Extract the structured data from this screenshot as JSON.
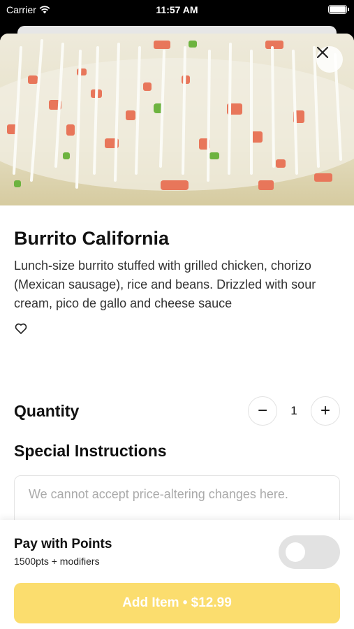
{
  "status_bar": {
    "carrier": "Carrier",
    "time": "11:57 AM"
  },
  "item": {
    "title": "Burrito California",
    "description": "Lunch-size burrito stuffed with grilled chicken, chorizo (Mexican sausage), rice and beans. Drizzled with sour cream, pico de gallo and cheese sauce",
    "favorited": false
  },
  "quantity": {
    "label": "Quantity",
    "value": "1",
    "decrement": "−",
    "increment": "+"
  },
  "special_instructions": {
    "label": "Special Instructions",
    "placeholder": "We cannot accept price-altering changes here."
  },
  "points": {
    "title": "Pay with Points",
    "subtitle": "1500pts + modifiers",
    "enabled": false
  },
  "add_button": {
    "label": "Add Item • $12.99"
  },
  "colors": {
    "accent": "#fbdd6e",
    "toggle_off": "#e2e2e2"
  }
}
